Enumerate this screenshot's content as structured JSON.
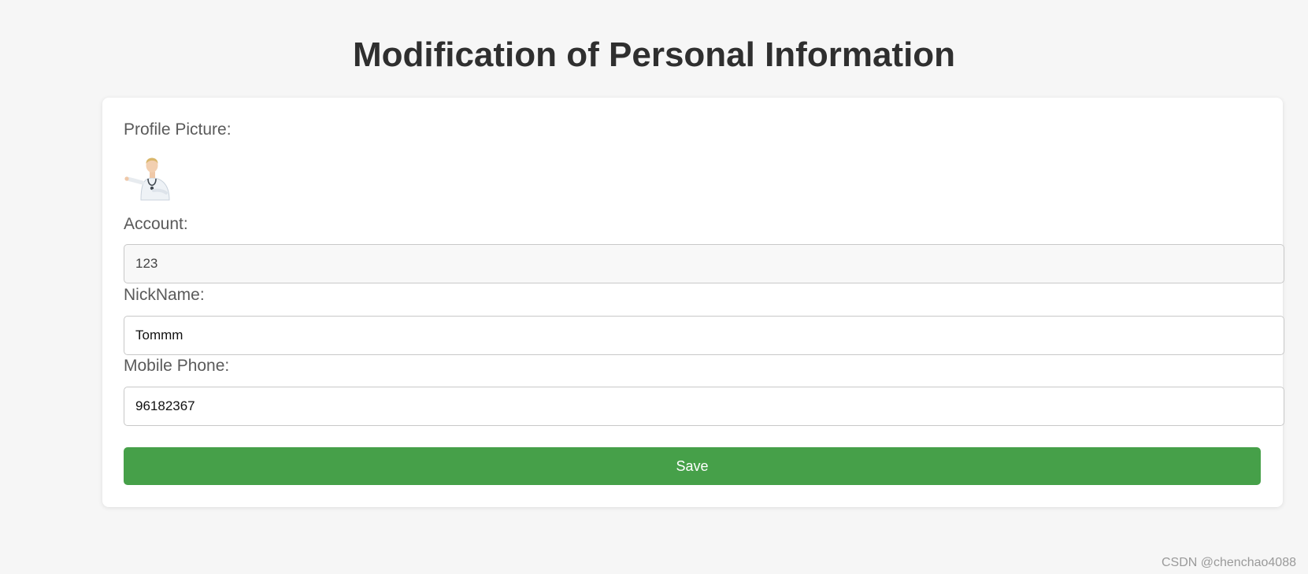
{
  "page": {
    "title": "Modification of Personal Information"
  },
  "form": {
    "profile_picture_label": "Profile Picture:",
    "avatar_icon": "doctor-avatar-image",
    "account_label": "Account:",
    "account_value": "123",
    "nickname_label": "NickName:",
    "nickname_value": "Tommm",
    "mobile_label": "Mobile Phone:",
    "mobile_value": "96182367",
    "save_label": "Save"
  },
  "watermark": {
    "text": "CSDN @chenchao4088"
  },
  "colors": {
    "background": "#f6f6f6",
    "card": "#ffffff",
    "save_button": "#46a049",
    "title_text": "#2f2f2f",
    "label_text": "#5a5a5a"
  }
}
